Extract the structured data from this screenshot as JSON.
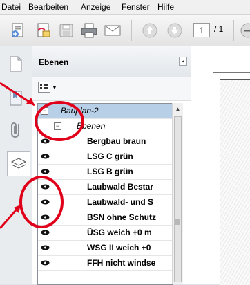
{
  "menu": [
    "Datei",
    "Bearbeiten",
    "Anzeige",
    "Fenster",
    "Hilfe"
  ],
  "toolbar": {
    "page_current": "1",
    "page_total": "/ 1"
  },
  "panel": {
    "title": "Ebenen",
    "collapse_symbol": "◂"
  },
  "layers": {
    "root": "Bauplan-2",
    "group": "Ebenen",
    "items": [
      "Bergbau braun",
      "LSG C grün",
      "LSG B grün",
      "Laubwald Bestar",
      "Laubwald- und S",
      "BSN ohne Schutz",
      "ÜSG weich +0 m",
      "WSG II weich +0",
      "FFH nicht windse"
    ]
  },
  "colors": {
    "annotation": "#e0001a",
    "selection": "#b8cfe8"
  }
}
